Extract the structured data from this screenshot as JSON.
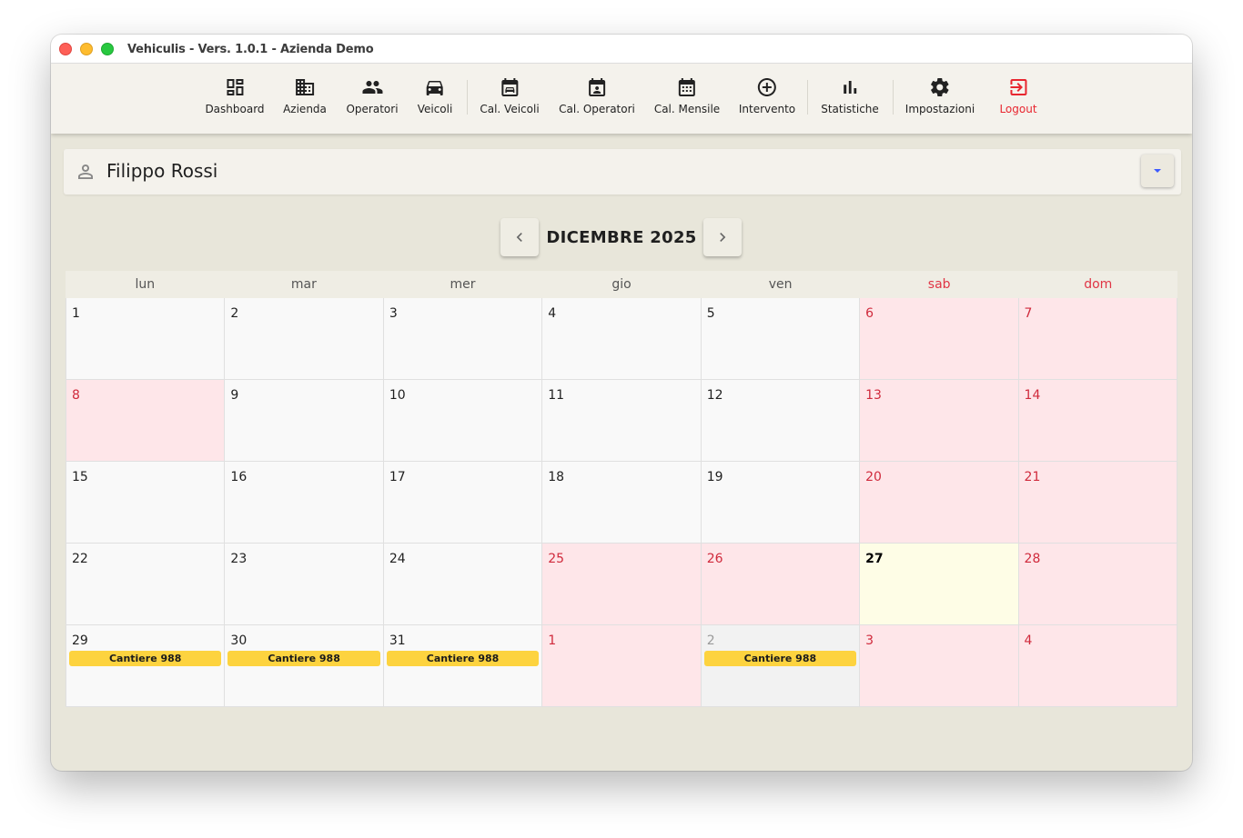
{
  "window": {
    "title": "Vehiculis - Vers. 1.0.1 - Azienda Demo"
  },
  "toolbar": {
    "items": [
      {
        "label": "Dashboard",
        "icon": "dashboard-icon"
      },
      {
        "label": "Azienda",
        "icon": "building-icon"
      },
      {
        "label": "Operatori",
        "icon": "people-icon"
      },
      {
        "label": "Veicoli",
        "icon": "car-icon"
      },
      {
        "label": "Cal. Veicoli",
        "icon": "calendar-car-icon"
      },
      {
        "label": "Cal. Operatori",
        "icon": "calendar-person-icon"
      },
      {
        "label": "Cal. Mensile",
        "icon": "calendar-grid-icon"
      },
      {
        "label": "Intervento",
        "icon": "add-circle-icon"
      },
      {
        "label": "Statistiche",
        "icon": "bar-chart-icon"
      },
      {
        "label": "Impostazioni",
        "icon": "gear-icon"
      },
      {
        "label": "Logout",
        "icon": "logout-icon"
      }
    ]
  },
  "operator": {
    "name": "Filippo Rossi",
    "icon": "person-icon"
  },
  "calendar": {
    "month_label": "DICEMBRE 2025",
    "weekdays": [
      "lun",
      "mar",
      "mer",
      "gio",
      "ven",
      "sab",
      "dom"
    ],
    "weekend_color": "#e03545",
    "event_color": "#fdd33f",
    "weeks": [
      [
        {
          "day": "1"
        },
        {
          "day": "2"
        },
        {
          "day": "3"
        },
        {
          "day": "4"
        },
        {
          "day": "5"
        },
        {
          "day": "6",
          "type": "weekend"
        },
        {
          "day": "7",
          "type": "weekend"
        }
      ],
      [
        {
          "day": "8",
          "type": "weekend"
        },
        {
          "day": "9"
        },
        {
          "day": "10"
        },
        {
          "day": "11"
        },
        {
          "day": "12"
        },
        {
          "day": "13",
          "type": "weekend"
        },
        {
          "day": "14",
          "type": "weekend"
        }
      ],
      [
        {
          "day": "15"
        },
        {
          "day": "16"
        },
        {
          "day": "17"
        },
        {
          "day": "18"
        },
        {
          "day": "19"
        },
        {
          "day": "20",
          "type": "weekend"
        },
        {
          "day": "21",
          "type": "weekend"
        }
      ],
      [
        {
          "day": "22"
        },
        {
          "day": "23"
        },
        {
          "day": "24"
        },
        {
          "day": "25",
          "type": "weekend"
        },
        {
          "day": "26",
          "type": "weekend"
        },
        {
          "day": "27",
          "type": "today"
        },
        {
          "day": "28",
          "type": "weekend"
        }
      ],
      [
        {
          "day": "29",
          "event": "Cantiere 988"
        },
        {
          "day": "30",
          "event": "Cantiere 988"
        },
        {
          "day": "31",
          "event": "Cantiere 988"
        },
        {
          "day": "1",
          "type": "weekend"
        },
        {
          "day": "2",
          "type": "outside",
          "event": "Cantiere 988"
        },
        {
          "day": "3",
          "type": "weekend"
        },
        {
          "day": "4",
          "type": "weekend"
        }
      ]
    ]
  }
}
